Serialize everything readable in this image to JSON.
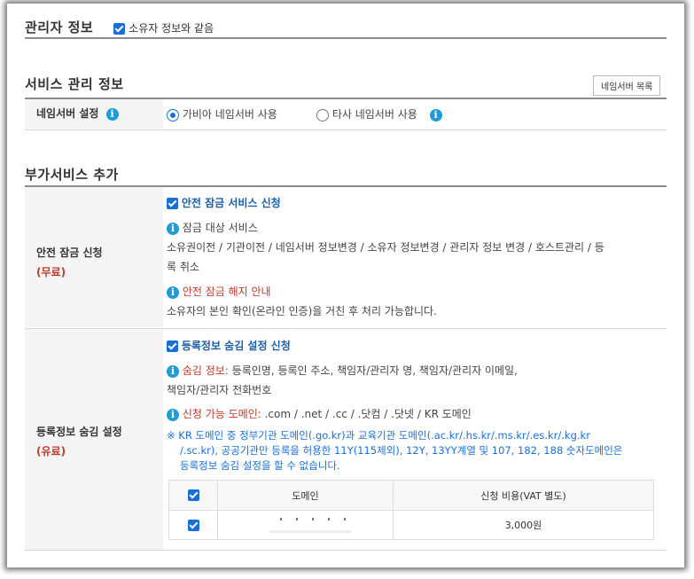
{
  "admin_info": {
    "title": "관리자 정보",
    "same_as_owner_label": "소유자 정보와 같음"
  },
  "service_info": {
    "title": "서비스 관리 정보",
    "nameserver_list_button": "네임서버 목록",
    "nameserver_setting_label": "네임서버 설정",
    "options": [
      {
        "label": "가비아 네임서버 사용",
        "selected": true
      },
      {
        "label": "타사 네임서버 사용",
        "selected": false
      }
    ]
  },
  "addon": {
    "title": "부가서비스 추가",
    "safe_lock": {
      "label": "안전 잠금 신청",
      "price_tag": "(무료)",
      "apply_label": "안전 잠금 서비스 신청",
      "target_title": "잠금 대상 서비스",
      "target_text_1": "소유권이전 / 기관이전 / 네임서버 정보변경 / 소유자 정보변경 / 관리자 정보 변경 / 호스트관리 / 등",
      "target_text_2": "록 취소",
      "release_title": "안전 잠금 해지 안내",
      "release_text": "소유자의 본인 확인(온라인 인증)을 거친 후 처리 가능합니다."
    },
    "privacy": {
      "label": "등록정보 숨김 설정",
      "price_tag": "(유료)",
      "apply_label": "등록정보 숨김 설정 신청",
      "hide_title": "숨김 정보:",
      "hide_text_1": " 등록인명, 등록인 주소, 책임자/관리자 명, 책임자/관리자 이메일,",
      "hide_text_2": "책임자/관리자 전화번호",
      "domains_title": "신청 가능 도메인:",
      "domains_text": " .com / .net / .cc / .닷컴 / .닷넷 / KR 도메인",
      "notice_1": "※ KR 도메인 중 정부기관 도메인(.go.kr)과 교육기관 도메인(.ac.kr/.hs.kr/.ms.kr/.es.kr/.kg.kr",
      "notice_2": "/.sc.kr), 공공기관만 등록을 허용한 11Y(115제외), 12Y, 13YY계열 및 107, 182, 188 숫자도메인은",
      "notice_3": "등록정보 숨김 설정을 할 수 없습니다.",
      "table": {
        "col_domain": "도메인",
        "col_fee": "신청 비용(VAT 별도)",
        "rows": [
          {
            "domain": "",
            "fee": "3,000원"
          }
        ]
      }
    }
  },
  "colors": {
    "accent": "#1a6fd6",
    "red": "#c0392b",
    "info": "#1f9bd6"
  }
}
